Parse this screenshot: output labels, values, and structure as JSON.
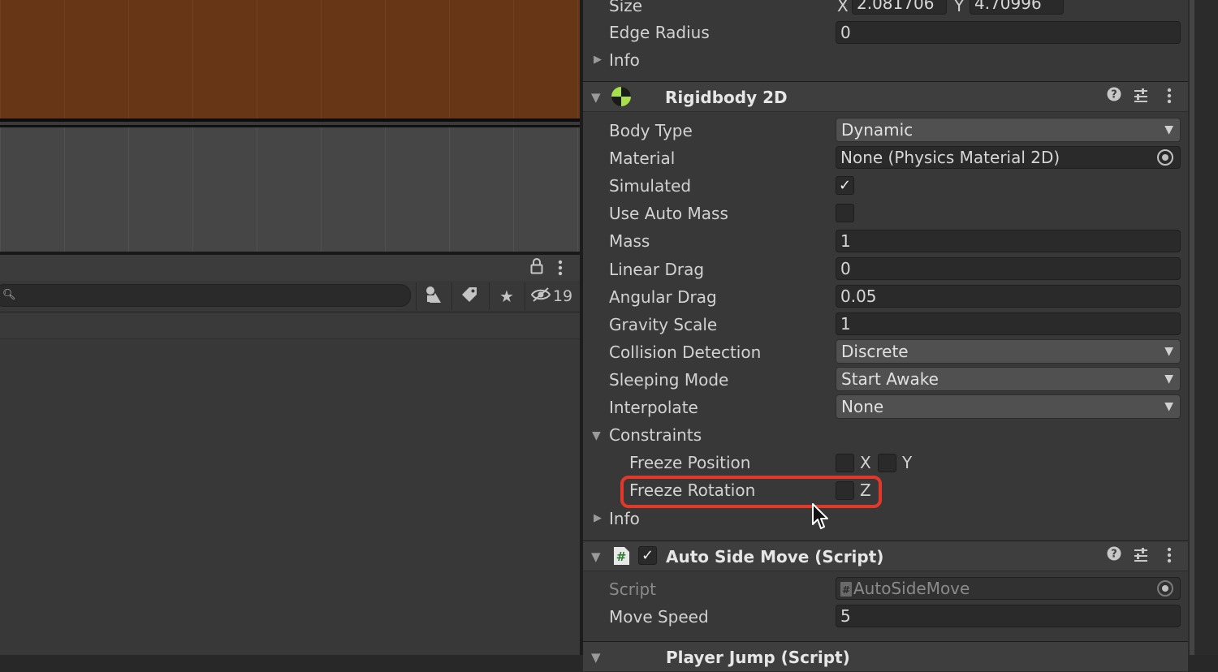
{
  "scene": {},
  "hierarchy": {
    "search": {
      "placeholder": ""
    },
    "hidden_count": "19"
  },
  "inspector": {
    "collider": {
      "size": {
        "label": "Size",
        "x_label": "X",
        "x": "2.081706",
        "y_label": "Y",
        "y": "4.70996"
      },
      "edge_radius": {
        "label": "Edge Radius",
        "value": "0"
      },
      "info": "Info"
    },
    "rigidbody": {
      "title": "Rigidbody 2D",
      "body_type": {
        "label": "Body Type",
        "value": "Dynamic"
      },
      "material": {
        "label": "Material",
        "value": "None (Physics Material 2D)"
      },
      "simulated": {
        "label": "Simulated",
        "checked": true
      },
      "use_auto_mass": {
        "label": "Use Auto Mass",
        "checked": false
      },
      "mass": {
        "label": "Mass",
        "value": "1"
      },
      "linear_drag": {
        "label": "Linear Drag",
        "value": "0"
      },
      "angular_drag": {
        "label": "Angular Drag",
        "value": "0.05"
      },
      "gravity_scale": {
        "label": "Gravity Scale",
        "value": "1"
      },
      "collision_detection": {
        "label": "Collision Detection",
        "value": "Discrete"
      },
      "sleeping_mode": {
        "label": "Sleeping Mode",
        "value": "Start Awake"
      },
      "interpolate": {
        "label": "Interpolate",
        "value": "None"
      },
      "constraints": {
        "label": "Constraints",
        "freeze_position": {
          "label": "Freeze Position",
          "x": "X",
          "y": "Y"
        },
        "freeze_rotation": {
          "label": "Freeze Rotation",
          "z": "Z"
        }
      },
      "info": "Info"
    },
    "auto_side_move": {
      "title": "Auto Side Move (Script)",
      "script": {
        "label": "Script",
        "value": "AutoSideMove"
      },
      "move_speed": {
        "label": "Move Speed",
        "value": "5"
      }
    },
    "player_jump": {
      "title": "Player Jump (Script)"
    }
  },
  "colors": {
    "highlight": "#e2382a",
    "scene_ground": "#673617"
  }
}
